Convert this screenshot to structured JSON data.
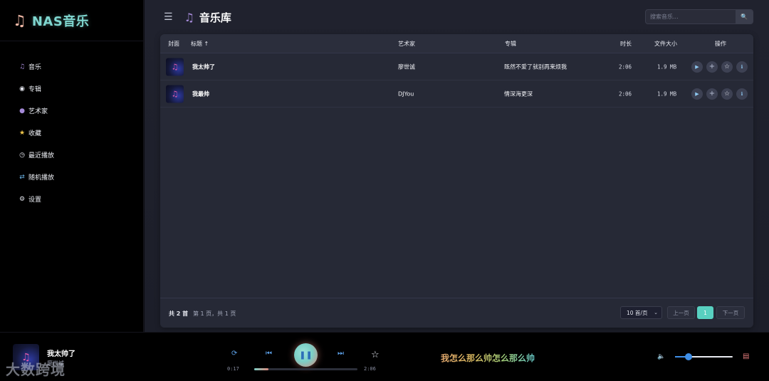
{
  "app": {
    "logo_icon": "music-note-icon",
    "name": "NAS音乐"
  },
  "sidebar": {
    "items": [
      {
        "label": "音乐",
        "icon": "♫"
      },
      {
        "label": "专辑",
        "icon": "●"
      },
      {
        "label": "艺术家",
        "icon": "👤"
      },
      {
        "label": "收藏",
        "icon": "★"
      },
      {
        "label": "最近播放",
        "icon": "◷"
      },
      {
        "label": "随机播放",
        "icon": "⇄"
      },
      {
        "label": "设置",
        "icon": "⚙"
      }
    ]
  },
  "header": {
    "menu_icon": "☰",
    "title_icon": "♫",
    "title": "音乐库",
    "search_placeholder": "搜索音乐...",
    "search_icon": "🔍"
  },
  "table": {
    "columns": {
      "cover": "封面",
      "title": "标题 ↑",
      "artist": "艺术家",
      "album": "专辑",
      "duration": "时长",
      "size": "文件大小",
      "actions": "操作"
    },
    "rows": [
      {
        "title": "我太帅了",
        "artist": "廖世诚",
        "album": "既然不爱了就别再来烦我",
        "duration": "2:06",
        "size": "1.9 MB"
      },
      {
        "title": "我最帅",
        "artist": "DJYou",
        "album": "情深海更深",
        "duration": "2:06",
        "size": "1.9 MB"
      }
    ]
  },
  "pagination": {
    "total": "共 2 首",
    "info": "第 1 页，共 1 页",
    "per_page": "10 首/页",
    "prev": "上一页",
    "current": "1",
    "next": "下一页"
  },
  "player": {
    "title": "我太帅了",
    "artist": "廖世诚",
    "current_time": "0:17",
    "total_time": "2:06",
    "progress": 0.14,
    "lyric": "我怎么那么帅怎么那么帅",
    "volume": 0.2
  },
  "watermark": "大数跨境"
}
